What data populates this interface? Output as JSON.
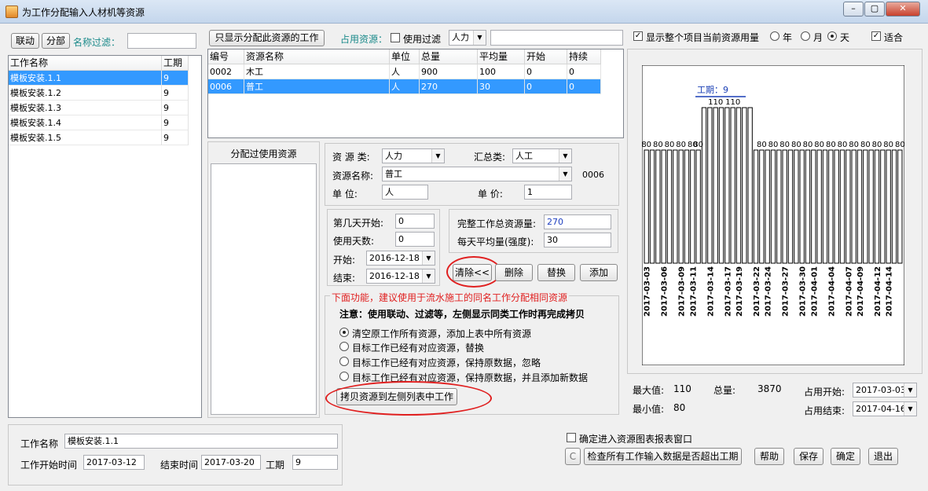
{
  "window": {
    "title": "为工作分配输入人材机等资源",
    "min": "–",
    "max": "▢",
    "close": "✕"
  },
  "left": {
    "link_btn": "联动",
    "split_btn": "分部",
    "filter_label": "名称过滤：",
    "filter_value": "",
    "headers": [
      "工作名称",
      "工期"
    ],
    "rows": [
      [
        "模板安装.1.1",
        "9"
      ],
      [
        "模板安装.1.2",
        "9"
      ],
      [
        "模板安装.1.3",
        "9"
      ],
      [
        "模板安装.1.4",
        "9"
      ],
      [
        "模板安装.1.5",
        "9"
      ]
    ]
  },
  "top": {
    "only_assigned_btn": "只显示分配此资源的工作",
    "occupy_label": "占用资源：",
    "use_filter_label": "使用过滤",
    "type_value": "人力",
    "filter_input": ""
  },
  "resource_table": {
    "headers": [
      "编号",
      "资源名称",
      "单位",
      "总量",
      "平均量",
      "开始",
      "持续"
    ],
    "rows": [
      [
        "0002",
        "木工",
        "人",
        "900",
        "100",
        "0",
        "0"
      ],
      [
        "0006",
        "普工",
        "人",
        "270",
        "30",
        "0",
        "0"
      ]
    ]
  },
  "used_resources": {
    "title": "分配过使用资源"
  },
  "form": {
    "type_label": "资 源 类:",
    "type_value": "人力",
    "summary_label": "汇总类:",
    "summary_value": "人工",
    "name_label": "资源名称:",
    "name_value": "普工",
    "code": "0006",
    "unit_label": "单    位:",
    "unit_value": "人",
    "price_label": "单    价:",
    "price_value": "1",
    "start_day_label": "第几天开始:",
    "start_day_value": "0",
    "use_days_label": "使用天数:",
    "use_days_value": "0",
    "start_label": "开始:",
    "start_value": "2016-12-18",
    "end_label": "结束:",
    "end_value": "2016-12-18",
    "total_label": "完整工作总资源量:",
    "total_value": "270",
    "daily_label": "每天平均量(强度):",
    "daily_value": "30",
    "clear_btn": "清除<<",
    "delete_btn": "删除",
    "replace_btn": "替换",
    "add_btn": "添加"
  },
  "copy_section": {
    "legend": "下面功能，建议使用于流水施工的同名工作分配相同资源",
    "note": "注意：使用联动、过滤等，左侧显示同类工作时再完成拷贝",
    "options": [
      "清空原工作所有资源，添加上表中所有资源",
      "目标工作已经有对应资源，替换",
      "目标工作已经有对应资源，保持原数据，忽略",
      "目标工作已经有对应资源，保持原数据，并且添加新数据"
    ],
    "selected_option": 0,
    "copy_btn": "拷贝资源到左侧列表中工作"
  },
  "chart_panel": {
    "show_all_label": "显示整个项目当前资源用量",
    "year": "年",
    "month": "月",
    "day": "天",
    "fit_label": "适合",
    "duration_label": "工期：9",
    "max_label": "最大值:",
    "max_value": "110",
    "total_label": "总量:",
    "total_value": "3870",
    "min_label": "最小值:",
    "min_value": "80",
    "occupy_start_label": "占用开始:",
    "occupy_start_value": "2017-03-03",
    "occupy_end_label": "占用结束:",
    "occupy_end_value": "2017-04-16"
  },
  "chart_data": {
    "type": "bar",
    "title": "",
    "xlabel": "",
    "ylabel": "",
    "categories": [
      "2017-03-03",
      "2017-03-04",
      "2017-03-05",
      "2017-03-06",
      "2017-03-07",
      "2017-03-08",
      "2017-03-09",
      "2017-03-10",
      "2017-03-11",
      "2017-03-12",
      "2017-03-13",
      "2017-03-14",
      "2017-03-15",
      "2017-03-16",
      "2017-03-17",
      "2017-03-18",
      "2017-03-19",
      "2017-03-20",
      "2017-03-21",
      "2017-03-22",
      "2017-03-23",
      "2017-03-24",
      "2017-03-25",
      "2017-03-26",
      "2017-03-27",
      "2017-03-28",
      "2017-03-29",
      "2017-03-30",
      "2017-03-31",
      "2017-04-01",
      "2017-04-02",
      "2017-04-03",
      "2017-04-04",
      "2017-04-05",
      "2017-04-06",
      "2017-04-07",
      "2017-04-08",
      "2017-04-09",
      "2017-04-10",
      "2017-04-11",
      "2017-04-12",
      "2017-04-13",
      "2017-04-14",
      "2017-04-15",
      "2017-04-16"
    ],
    "values": [
      80,
      80,
      80,
      80,
      80,
      80,
      80,
      80,
      80,
      80,
      110,
      110,
      110,
      110,
      110,
      110,
      110,
      110,
      110,
      80,
      80,
      80,
      80,
      80,
      80,
      80,
      80,
      80,
      80,
      80,
      80,
      80,
      80,
      80,
      80,
      80,
      80,
      80,
      80,
      80,
      80,
      80,
      80,
      80,
      80
    ],
    "visible_labels": {
      "2017-03-12": "110",
      "2017-03-15": "110",
      "2017-03-18": "110"
    },
    "tick_labels": [
      "2017-03-03",
      "2017-03-06",
      "2017-03-09",
      "2017-03-11",
      "2017-03-14",
      "2017-03-17",
      "2017-03-19",
      "2017-03-22",
      "2017-03-24",
      "2017-03-27",
      "2017-03-30",
      "2017-04-01",
      "2017-04-04",
      "2017-04-07",
      "2017-04-09",
      "2017-04-12",
      "2017-04-14"
    ],
    "ylim": [
      0,
      140
    ],
    "grid": false
  },
  "bottom": {
    "work_name_label": "工作名称",
    "work_name_value": "模板安装.1.1",
    "start_label": "工作开始时间",
    "start_value": "2017-03-12",
    "end_label": "结束时间",
    "end_value": "2017-03-20",
    "duration_label": "工期",
    "duration_value": "9",
    "report_label": "确定进入资源图表报表窗口",
    "c_btn": "C",
    "check_btn": "检查所有工作输入数据是否超出工期",
    "help_btn": "帮助",
    "save_btn": "保存",
    "ok_btn": "确定",
    "exit_btn": "退出"
  }
}
